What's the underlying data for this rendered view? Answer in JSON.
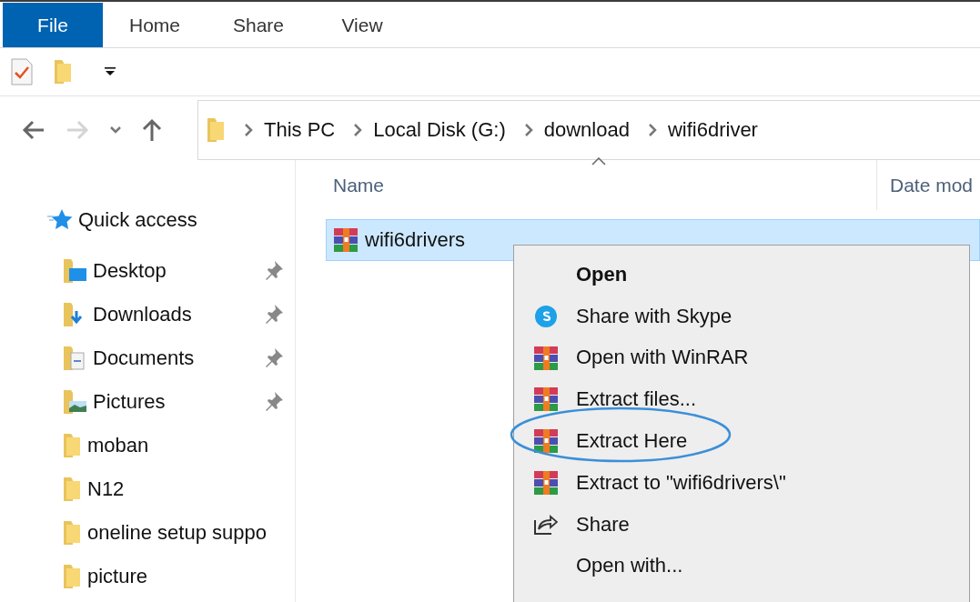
{
  "ribbon": {
    "tabs": [
      {
        "label": "File",
        "selected": true
      },
      {
        "label": "Home",
        "selected": false
      },
      {
        "label": "Share",
        "selected": false
      },
      {
        "label": "View",
        "selected": false
      }
    ]
  },
  "navigation": {
    "back_disabled": false,
    "forward_disabled": true
  },
  "breadcrumb": [
    "This PC",
    "Local Disk (G:)",
    "download",
    "wifi6driver"
  ],
  "sidebar": {
    "header": "Quick access",
    "items": [
      {
        "label": "Desktop",
        "kind": "desktop",
        "pinned": true
      },
      {
        "label": "Downloads",
        "kind": "downloads",
        "pinned": true
      },
      {
        "label": "Documents",
        "kind": "documents",
        "pinned": true
      },
      {
        "label": "Pictures",
        "kind": "pictures",
        "pinned": true
      },
      {
        "label": "moban",
        "kind": "folder",
        "pinned": false
      },
      {
        "label": "N12",
        "kind": "folder",
        "pinned": false
      },
      {
        "label": "oneline setup suppo",
        "kind": "folder",
        "pinned": false
      },
      {
        "label": "picture",
        "kind": "folder",
        "pinned": false
      }
    ]
  },
  "file_list": {
    "columns": [
      "Name",
      "Date mod"
    ],
    "rows": [
      {
        "name": "wifi6drivers",
        "selected": true
      }
    ]
  },
  "context_menu": {
    "items": [
      {
        "label": "Open",
        "kind": "default",
        "circled": false
      },
      {
        "label": "Share with Skype",
        "kind": "skype",
        "circled": false
      },
      {
        "label": "Open with WinRAR",
        "kind": "winrar",
        "circled": false
      },
      {
        "label": "Extract files...",
        "kind": "winrar",
        "circled": false
      },
      {
        "label": "Extract Here",
        "kind": "winrar",
        "circled": true
      },
      {
        "label": "Extract to \"wifi6drivers\\\"",
        "kind": "winrar",
        "circled": false
      },
      {
        "label": "Share",
        "kind": "share",
        "circled": false
      },
      {
        "label": "Open with...",
        "kind": "plain",
        "circled": false
      }
    ]
  }
}
